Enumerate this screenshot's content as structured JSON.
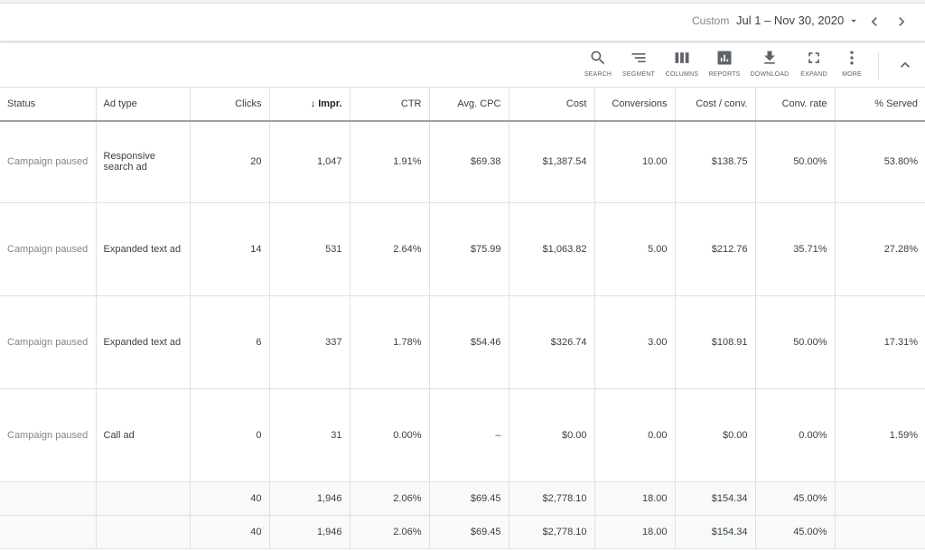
{
  "date": {
    "label": "Custom",
    "range": "Jul 1 – Nov 30, 2020"
  },
  "toolbar": {
    "items": [
      {
        "label": "SEARCH",
        "icon": "search-icon"
      },
      {
        "label": "SEGMENT",
        "icon": "segment-icon"
      },
      {
        "label": "COLUMNS",
        "icon": "columns-icon"
      },
      {
        "label": "REPORTS",
        "icon": "reports-icon"
      },
      {
        "label": "DOWNLOAD",
        "icon": "download-icon"
      },
      {
        "label": "EXPAND",
        "icon": "expand-icon"
      },
      {
        "label": "MORE",
        "icon": "more-vert-icon"
      }
    ]
  },
  "table": {
    "sort_arrow": "↓",
    "headers": [
      "Status",
      "Ad type",
      "Clicks",
      "Impr.",
      "CTR",
      "Avg. CPC",
      "Cost",
      "Conversions",
      "Cost / conv.",
      "Conv. rate",
      "% Served"
    ],
    "rows": [
      [
        "Campaign paused",
        "Responsive search ad",
        "20",
        "1,047",
        "1.91%",
        "$69.38",
        "$1,387.54",
        "10.00",
        "$138.75",
        "50.00%",
        "53.80%"
      ],
      [
        "Campaign paused",
        "Expanded text ad",
        "14",
        "531",
        "2.64%",
        "$75.99",
        "$1,063.82",
        "5.00",
        "$212.76",
        "35.71%",
        "27.28%"
      ],
      [
        "Campaign paused",
        "Expanded text ad",
        "6",
        "337",
        "1.78%",
        "$54.46",
        "$326.74",
        "3.00",
        "$108.91",
        "50.00%",
        "17.31%"
      ],
      [
        "Campaign paused",
        "Call ad",
        "0",
        "31",
        "0.00%",
        "–",
        "$0.00",
        "0.00",
        "$0.00",
        "0.00%",
        "1.59%"
      ]
    ],
    "totals": [
      [
        "",
        "",
        "40",
        "1,946",
        "2.06%",
        "$69.45",
        "$2,778.10",
        "18.00",
        "$154.34",
        "45.00%",
        ""
      ],
      [
        "",
        "",
        "40",
        "1,946",
        "2.06%",
        "$69.45",
        "$2,778.10",
        "18.00",
        "$154.34",
        "45.00%",
        ""
      ]
    ]
  }
}
